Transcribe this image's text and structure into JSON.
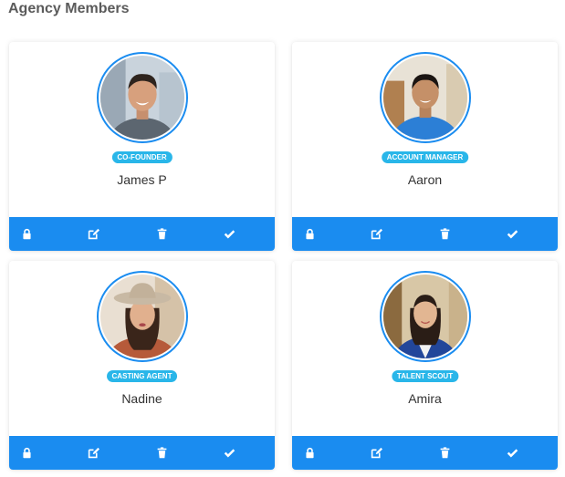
{
  "page": {
    "title": "Agency Members"
  },
  "colors": {
    "accent": "#1a8cf0",
    "badge": "#29b6e9"
  },
  "members": [
    {
      "name": "James P",
      "role": "CO-FOUNDER",
      "photo": "smiling man in grey shirt"
    },
    {
      "name": "Aaron",
      "role": "ACCOUNT MANAGER",
      "photo": "man in blue shirt"
    },
    {
      "name": "Nadine",
      "role": "CASTING AGENT",
      "photo": "woman in hat"
    },
    {
      "name": "Amira",
      "role": "TALENT SCOUT",
      "photo": "woman in blue cardigan"
    }
  ],
  "actions": [
    {
      "icon": "lock-icon"
    },
    {
      "icon": "edit-icon"
    },
    {
      "icon": "trash-icon"
    },
    {
      "icon": "check-icon"
    }
  ]
}
